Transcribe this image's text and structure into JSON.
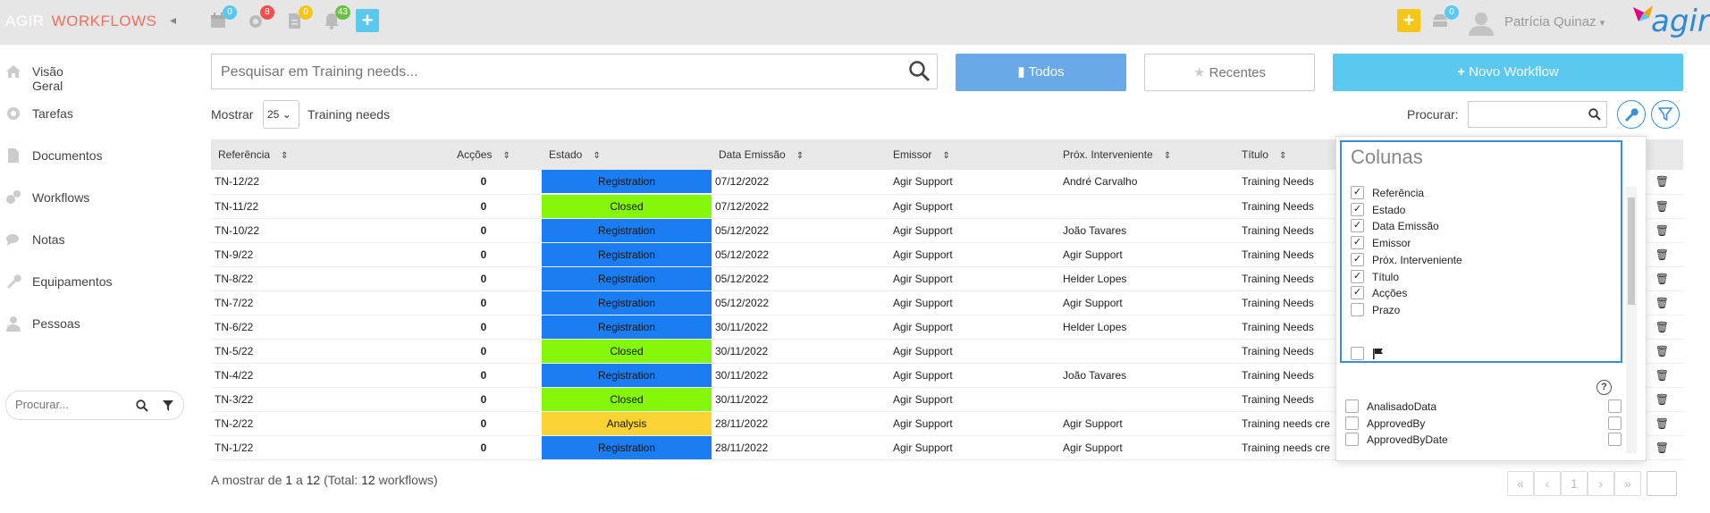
{
  "topbar": {
    "brand": "AGIR",
    "brand_sub": "WORKFLOWS",
    "badges": {
      "calendar": "0",
      "settings": "8",
      "documents": "0",
      "notifications": "43",
      "messages": "0"
    },
    "user_name": "Patrícia Quinaz",
    "logo_text": "agir"
  },
  "sidebar": {
    "items": [
      {
        "label": "Visão Geral",
        "icon": "home-icon"
      },
      {
        "label": "Tarefas",
        "icon": "gear-icon"
      },
      {
        "label": "Documentos",
        "icon": "document-icon"
      },
      {
        "label": "Workflows",
        "icon": "gears-icon"
      },
      {
        "label": "Notas",
        "icon": "comments-icon"
      },
      {
        "label": "Equipamentos",
        "icon": "wrench-icon"
      },
      {
        "label": "Pessoas",
        "icon": "user-icon"
      }
    ],
    "search_placeholder": "Procurar..."
  },
  "main": {
    "search_placeholder": "Pesquisar em Training needs...",
    "btn_todos": "Todos",
    "btn_recentes": "Recentes",
    "btn_novo": "Novo Workflow",
    "mostrar": "Mostrar",
    "page_size": "25",
    "entity_label": "Training needs",
    "procurar": "Procurar:",
    "columns": [
      "Referência",
      "Acções",
      "Estado",
      "Data Emissão",
      "Emissor",
      "Próx. Interveniente",
      "Título"
    ],
    "rows": [
      {
        "ref": "TN-12/22",
        "acc": "0",
        "estado": "Registration",
        "data": "07/12/2022",
        "emissor": "Agir Support",
        "prox": "André Carvalho",
        "titulo": "Training Needs"
      },
      {
        "ref": "TN-11/22",
        "acc": "0",
        "estado": "Closed",
        "data": "07/12/2022",
        "emissor": "Agir Support",
        "prox": "",
        "titulo": "Training Needs"
      },
      {
        "ref": "TN-10/22",
        "acc": "0",
        "estado": "Registration",
        "data": "05/12/2022",
        "emissor": "Agir Support",
        "prox": "João Tavares",
        "titulo": "Training Needs"
      },
      {
        "ref": "TN-9/22",
        "acc": "0",
        "estado": "Registration",
        "data": "05/12/2022",
        "emissor": "Agir Support",
        "prox": "Agir Support",
        "titulo": "Training Needs"
      },
      {
        "ref": "TN-8/22",
        "acc": "0",
        "estado": "Registration",
        "data": "05/12/2022",
        "emissor": "Agir Support",
        "prox": "Helder Lopes",
        "titulo": "Training Needs"
      },
      {
        "ref": "TN-7/22",
        "acc": "0",
        "estado": "Registration",
        "data": "05/12/2022",
        "emissor": "Agir Support",
        "prox": "Agir Support",
        "titulo": "Training Needs"
      },
      {
        "ref": "TN-6/22",
        "acc": "0",
        "estado": "Registration",
        "data": "30/11/2022",
        "emissor": "Agir Support",
        "prox": "Helder Lopes",
        "titulo": "Training Needs"
      },
      {
        "ref": "TN-5/22",
        "acc": "0",
        "estado": "Closed",
        "data": "30/11/2022",
        "emissor": "Agir Support",
        "prox": "",
        "titulo": "Training Needs"
      },
      {
        "ref": "TN-4/22",
        "acc": "0",
        "estado": "Registration",
        "data": "30/11/2022",
        "emissor": "Agir Support",
        "prox": "João Tavares",
        "titulo": "Training Needs"
      },
      {
        "ref": "TN-3/22",
        "acc": "0",
        "estado": "Closed",
        "data": "30/11/2022",
        "emissor": "Agir Support",
        "prox": "",
        "titulo": "Training Needs"
      },
      {
        "ref": "TN-2/22",
        "acc": "0",
        "estado": "Analysis",
        "data": "28/11/2022",
        "emissor": "Agir Support",
        "prox": "Agir Support",
        "titulo": "Training needs cre"
      },
      {
        "ref": "TN-1/22",
        "acc": "0",
        "estado": "Registration",
        "data": "28/11/2022",
        "emissor": "Agir Support",
        "prox": "Agir Support",
        "titulo": "Training needs cre"
      }
    ],
    "footer_prefix": "A mostrar de ",
    "footer_from": "1",
    "footer_mid": " a ",
    "footer_to": "12",
    "footer_total_prefix": " (Total: ",
    "footer_total": "12",
    "footer_suffix": " workflows)",
    "pager_current": "1"
  },
  "columns_popup": {
    "title": "Colunas",
    "items": [
      {
        "label": "Referência",
        "checked": true
      },
      {
        "label": "Estado",
        "checked": true
      },
      {
        "label": "Data Emissão",
        "checked": true
      },
      {
        "label": "Emissor",
        "checked": true
      },
      {
        "label": "Próx. Interveniente",
        "checked": true
      },
      {
        "label": "Título",
        "checked": true
      },
      {
        "label": "Acções",
        "checked": true
      },
      {
        "label": "Prazo",
        "checked": false
      }
    ],
    "extra_items": [
      "AnalisadoData",
      "ApprovedBy",
      "ApprovedByDate"
    ]
  },
  "colors": {
    "registration": "#1a7ef2",
    "closed": "#84f808",
    "analysis": "#fbd335",
    "accent": "#3a8ed8"
  }
}
